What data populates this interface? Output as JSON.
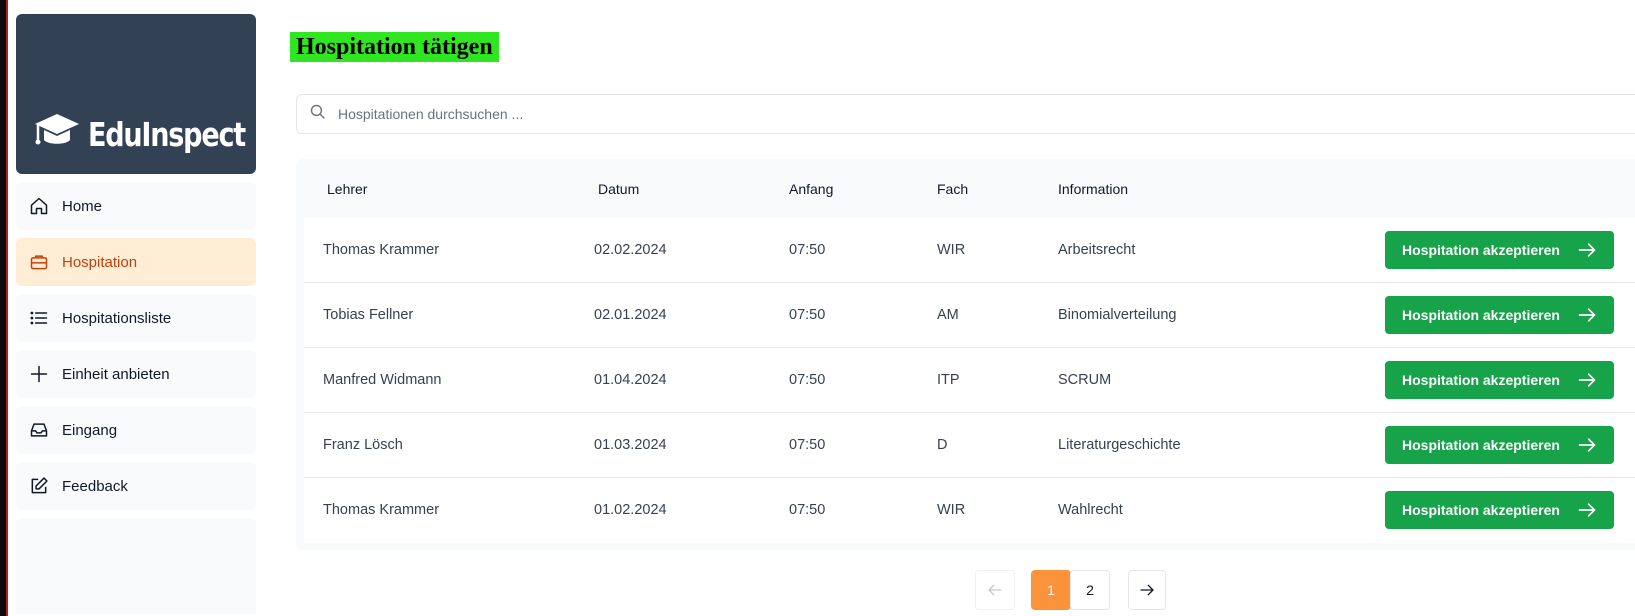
{
  "app": {
    "brand": "EduInspect"
  },
  "sidebar": {
    "items": [
      {
        "label": "Home",
        "icon": "home-icon"
      },
      {
        "label": "Hospitation",
        "icon": "briefcase-icon",
        "active": true
      },
      {
        "label": "Hospitationsliste",
        "icon": "list-icon"
      },
      {
        "label": "Einheit anbieten",
        "icon": "plus-icon"
      },
      {
        "label": "Eingang",
        "icon": "inbox-icon"
      },
      {
        "label": "Feedback",
        "icon": "edit-icon"
      }
    ]
  },
  "page": {
    "title": "Hospitation tätigen",
    "title_highlight": "#2fe620"
  },
  "search": {
    "placeholder": "Hospitationen durchsuchen ...",
    "icon": "search-icon"
  },
  "table": {
    "headers": [
      "Lehrer",
      "Datum",
      "Anfang",
      "Fach",
      "Information"
    ],
    "rows": [
      {
        "lehrer": "Thomas Krammer",
        "datum": "02.02.2024",
        "anfang": "07:50",
        "fach": "WIR",
        "information": "Arbeitsrecht",
        "action": "Hospitation akzeptieren"
      },
      {
        "lehrer": "Tobias Fellner",
        "datum": "02.01.2024",
        "anfang": "07:50",
        "fach": "AM",
        "information": "Binomialverteilung",
        "action": "Hospitation akzeptieren"
      },
      {
        "lehrer": "Manfred Widmann",
        "datum": "01.04.2024",
        "anfang": "07:50",
        "fach": "ITP",
        "information": "SCRUM",
        "action": "Hospitation akzeptieren"
      },
      {
        "lehrer": "Franz Lösch",
        "datum": "01.03.2024",
        "anfang": "07:50",
        "fach": "D",
        "information": "Literaturgeschichte",
        "action": "Hospitation akzeptieren"
      },
      {
        "lehrer": "Thomas Krammer",
        "datum": "01.02.2024",
        "anfang": "07:50",
        "fach": "WIR",
        "information": "Wahlrecht",
        "action": "Hospitation akzeptieren"
      }
    ]
  },
  "pagination": {
    "pages": [
      "1",
      "2"
    ],
    "current": "1",
    "prev_icon": "arrow-left-icon",
    "next_icon": "arrow-right-icon"
  },
  "colors": {
    "accent": "#16a34a",
    "active_bg": "#ffedd5",
    "active_text": "#c2410c",
    "page_active": "#fb923c",
    "logo_bg": "#334155"
  }
}
